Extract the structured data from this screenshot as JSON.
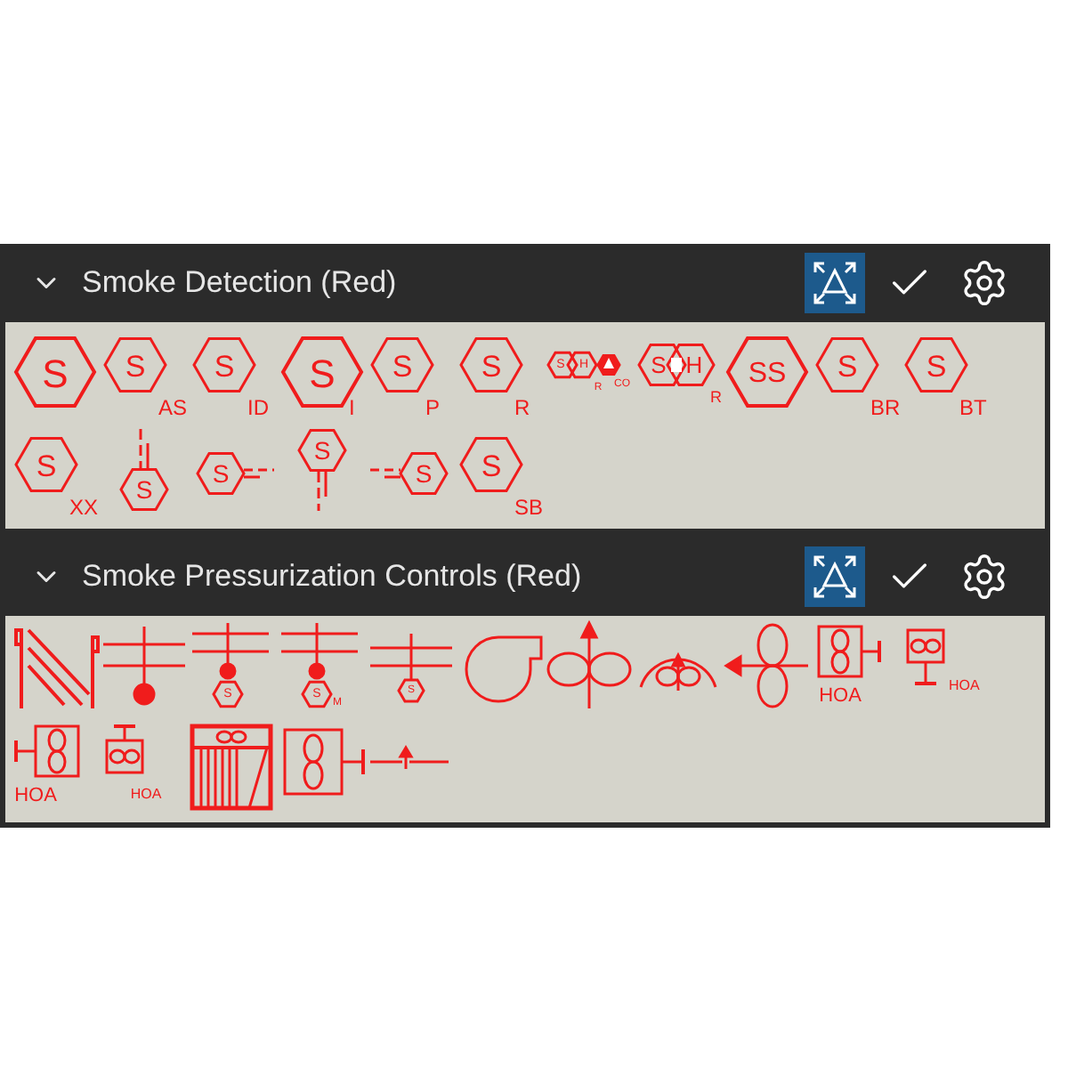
{
  "sections": [
    {
      "title": "Smoke Detection (Red)",
      "expanded": true,
      "tools": [
        {
          "kind": "fit",
          "selected": true
        },
        {
          "kind": "check"
        },
        {
          "kind": "settings"
        }
      ],
      "symbols": [
        {
          "kind": "hex-large",
          "label": "S"
        },
        {
          "kind": "hex",
          "label": "S",
          "sub": "AS"
        },
        {
          "kind": "hex",
          "label": "S",
          "sub": "ID"
        },
        {
          "kind": "hex-large",
          "label": "S",
          "sub": "I"
        },
        {
          "kind": "hex",
          "label": "S",
          "sub": "P"
        },
        {
          "kind": "hex",
          "label": "S",
          "sub": "R"
        },
        {
          "kind": "hex-pair-co",
          "labels": [
            "S",
            "H",
            "R",
            "CO"
          ]
        },
        {
          "kind": "hex-pair",
          "labels": [
            "S",
            "H"
          ],
          "sub": "R"
        },
        {
          "kind": "hex-large",
          "label": "SS"
        },
        {
          "kind": "hex",
          "label": "S",
          "sub": "BR"
        },
        {
          "kind": "hex",
          "label": "S",
          "sub": "BT"
        },
        {
          "kind": "hex",
          "label": "S",
          "sub": "XX"
        },
        {
          "kind": "hex-line-top",
          "label": "S"
        },
        {
          "kind": "hex-line-right",
          "label": "S"
        },
        {
          "kind": "hex-line-bottom",
          "label": "S"
        },
        {
          "kind": "hex-line-left",
          "label": "S"
        },
        {
          "kind": "hex",
          "label": "S",
          "sub": "SB"
        }
      ]
    },
    {
      "title": "Smoke Pressurization Controls (Red)",
      "expanded": true,
      "tools": [
        {
          "kind": "fit",
          "selected": true
        },
        {
          "kind": "check"
        },
        {
          "kind": "settings"
        }
      ],
      "symbols": [
        {
          "kind": "damper"
        },
        {
          "kind": "pole-dot"
        },
        {
          "kind": "pole-dot-hex",
          "label": "S"
        },
        {
          "kind": "pole-dot-hex",
          "label": "S",
          "sub": "M"
        },
        {
          "kind": "pole-hex",
          "label": "S"
        },
        {
          "kind": "blower"
        },
        {
          "kind": "fan-arrow-up"
        },
        {
          "kind": "fan-arc"
        },
        {
          "kind": "fan-arrow-left"
        },
        {
          "kind": "box-fan-hoa-right",
          "label": "HOA"
        },
        {
          "kind": "box-inf-hoa-bottom",
          "label": "HOA"
        },
        {
          "kind": "box-fan-hoa-left",
          "label": "HOA"
        },
        {
          "kind": "box-inf-hoa-top",
          "label": "HOA"
        },
        {
          "kind": "filter-unit"
        },
        {
          "kind": "box-fan-line"
        }
      ]
    }
  ]
}
